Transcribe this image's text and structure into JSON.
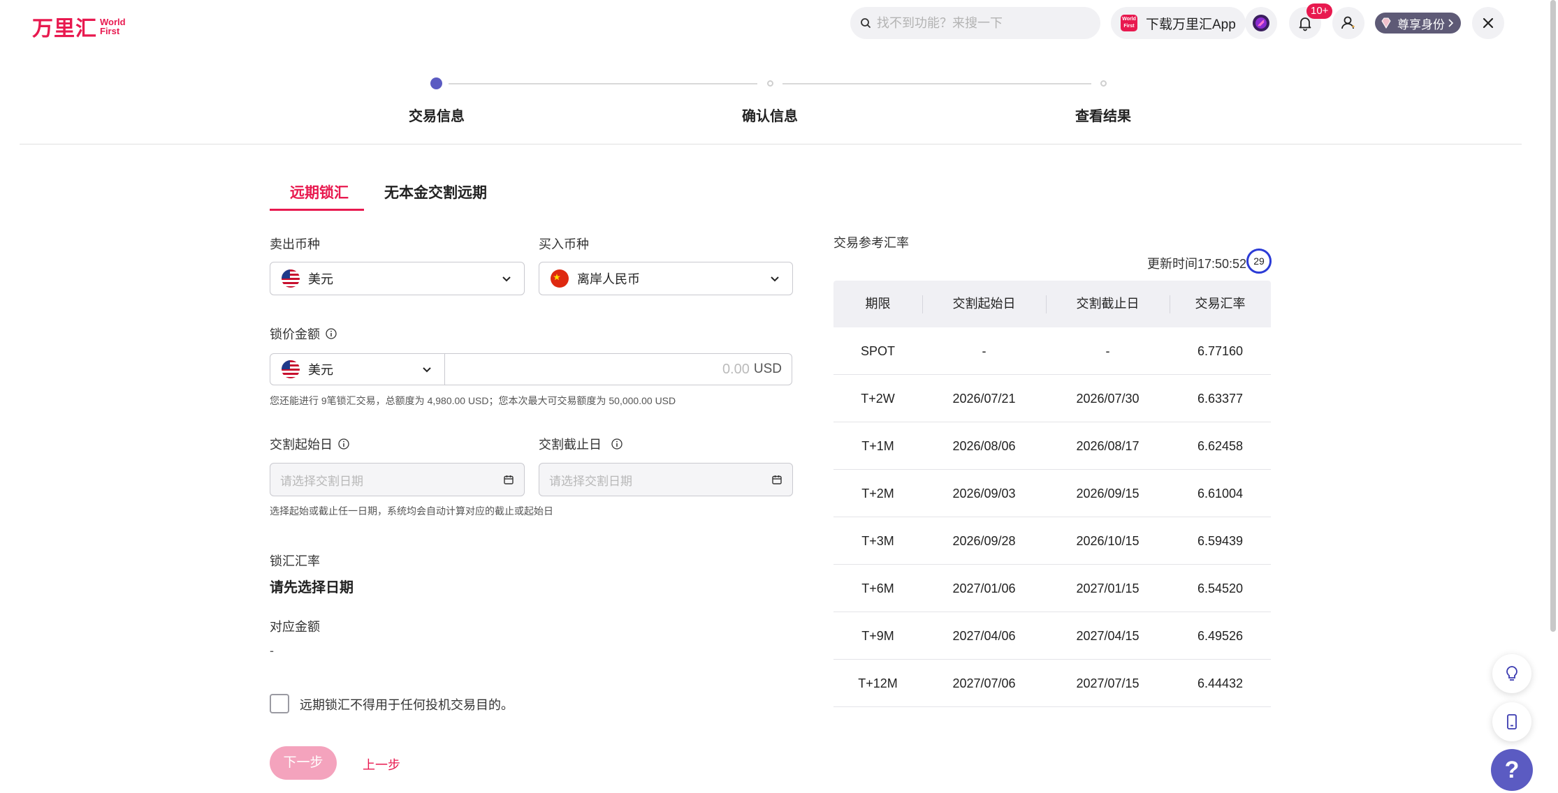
{
  "header": {
    "logo_cn": "万里汇",
    "logo_en_1": "World",
    "logo_en_2": "First",
    "search_placeholder": "找不到功能？来搜一下",
    "download_app_label": "下载万里汇App",
    "app_icon_text": "World First",
    "notification_badge": "10+",
    "vip_label": "尊享身份",
    "close_label": "X"
  },
  "stepper": {
    "steps": [
      {
        "label": "交易信息",
        "state": "active"
      },
      {
        "label": "确认信息",
        "state": "pending"
      },
      {
        "label": "查看结果",
        "state": "pending"
      }
    ]
  },
  "tabs": [
    {
      "label": "远期锁汇",
      "active": true
    },
    {
      "label": "无本金交割远期",
      "active": false
    }
  ],
  "form": {
    "sell_label": "卖出币种",
    "sell_value": "美元",
    "buy_label": "买入币种",
    "buy_value": "离岸人民币",
    "lock_amount_label": "锁价金额",
    "lock_amount_currency": "美元",
    "amount_value": "0.00",
    "amount_unit": "USD",
    "amount_hint": "您还能进行 9笔锁汇交易，总额度为 4,980.00 USD；您本次最大可交易额度为 50,000.00 USD",
    "start_label": "交割起始日",
    "end_label": "交割截止日",
    "start_placeholder": "请选择交割日期",
    "end_placeholder": "请选择交割日期",
    "date_hint": "选择起始或截止任一日期，系统均会自动计算对应的截止或起始日",
    "rate_label": "锁汇汇率",
    "rate_value": "请先选择日期",
    "corresponding_amount_label": "对应金额",
    "corresponding_amount_value": "-",
    "agreement_label": "远期锁汇不得用于任何投机交易目的。",
    "agreement_checked": false,
    "next_button": "下一步",
    "prev_button": "上一步"
  },
  "rate_table": {
    "title": "交易参考汇率",
    "update_time": "更新时间17:50:52",
    "countdown": "29",
    "columns": [
      "期限",
      "交割起始日",
      "交割截止日",
      "交易汇率"
    ],
    "rows": [
      [
        "SPOT",
        "-",
        "-",
        "6.77160"
      ],
      [
        "T+2W",
        "2026/07/21",
        "2026/07/30",
        "6.63377"
      ],
      [
        "T+1M",
        "2026/08/06",
        "2026/08/17",
        "6.62458"
      ],
      [
        "T+2M",
        "2026/09/03",
        "2026/09/15",
        "6.61004"
      ],
      [
        "T+3M",
        "2026/09/28",
        "2026/10/15",
        "6.59439"
      ],
      [
        "T+6M",
        "2027/01/06",
        "2027/01/15",
        "6.54520"
      ],
      [
        "T+9M",
        "2027/04/06",
        "2027/04/15",
        "6.49526"
      ],
      [
        "T+12M",
        "2027/07/06",
        "2027/07/15",
        "6.44432"
      ]
    ]
  },
  "floating": {
    "help_label": "?"
  },
  "colors": {
    "brand": "#e8194f",
    "step_active": "#5b5bc2",
    "button_disabled": "#f4a3bd",
    "timer_ring": "#2b3bd6"
  }
}
